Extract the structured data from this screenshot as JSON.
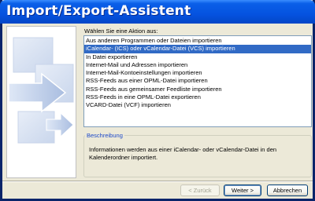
{
  "window": {
    "title": "Import/Export-Assistent"
  },
  "prompt": "Wählen Sie eine Aktion aus:",
  "actions": [
    "Aus anderen Programmen oder Dateien importieren",
    "iCalendar- (ICS) oder vCalendar-Datei (VCS) importieren",
    "In Datei exportieren",
    "Internet-Mail und Adressen importieren",
    "Internet-Mail-Kontoeinstellungen importieren",
    "RSS-Feeds aus einer OPML-Datei importieren",
    "RSS-Feeds aus gemeinsamer Feedliste importieren",
    "RSS-Feeds in eine OPML-Datei exportieren",
    "VCARD-Datei (VCF) importieren"
  ],
  "selected_index": 1,
  "description": {
    "title": "Beschreibung",
    "text": "Informationen werden aus einer iCalendar- oder vCalendar-Datei in den Kalenderordner importiert."
  },
  "buttons": {
    "back": "< Zurück",
    "next": "Weiter >",
    "cancel": "Abbrechen"
  },
  "colors": {
    "titlebar": "#0553e0",
    "selection": "#316ac5",
    "dialog": "#ece9d8"
  }
}
